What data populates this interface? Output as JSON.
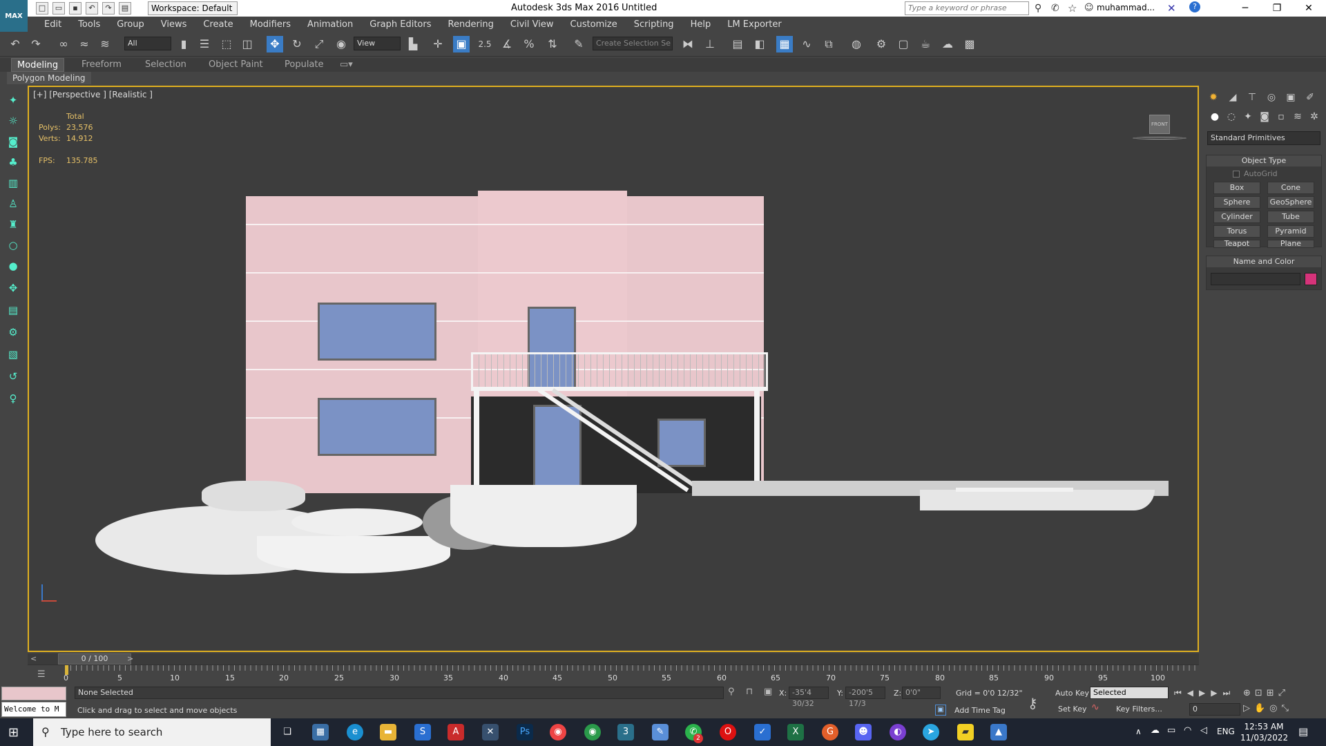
{
  "titlebar": {
    "workspace": "Workspace: Default",
    "app_title": "Autodesk 3ds Max 2016",
    "doc_title": "Untitled",
    "search_placeholder": "Type a keyword or phrase",
    "user": "muhammad..."
  },
  "menu": [
    "Edit",
    "Tools",
    "Group",
    "Views",
    "Create",
    "Modifiers",
    "Animation",
    "Graph Editors",
    "Rendering",
    "Civil View",
    "Customize",
    "Scripting",
    "Help",
    "LM Exporter"
  ],
  "toolbar": {
    "filter_value": "All",
    "ref_coord_value": "View",
    "snap_label": "2.5",
    "selection_set_placeholder": "Create Selection Se"
  },
  "ribbon": {
    "tabs": [
      "Modeling",
      "Freeform",
      "Selection",
      "Object Paint",
      "Populate"
    ],
    "panel_label": "Polygon Modeling"
  },
  "viewport": {
    "label": "[+] [Perspective ] [Realistic ]",
    "stats": {
      "total_label": "Total",
      "polys_label": "Polys:",
      "polys_value": "23,576",
      "verts_label": "Verts:",
      "verts_value": "14,912",
      "fps_label": "FPS:",
      "fps_value": "135.785"
    },
    "viewcube_label": "FRONT"
  },
  "command_panel": {
    "category_dropdown": "Standard Primitives",
    "object_type_title": "Object Type",
    "autogrid_label": "AutoGrid",
    "object_buttons": [
      "Box",
      "Cone",
      "Sphere",
      "GeoSphere",
      "Cylinder",
      "Tube",
      "Torus",
      "Pyramid",
      "Teapot",
      "Plane"
    ],
    "name_color_title": "Name and Color",
    "color_swatch": "#d6337a"
  },
  "timeline": {
    "slider_label": "0 / 100",
    "ticks": [
      "0",
      "5",
      "10",
      "15",
      "20",
      "25",
      "30",
      "35",
      "40",
      "45",
      "50",
      "55",
      "60",
      "65",
      "70",
      "75",
      "80",
      "85",
      "90",
      "95",
      "100"
    ]
  },
  "statusbar": {
    "script_listener": "Welcome to M",
    "selection_status": "None Selected",
    "prompt": "Click and drag to select and move objects",
    "x_label": "X:",
    "x_value": "-35'4 30/32",
    "y_label": "Y:",
    "y_value": "-200'5 17/3",
    "z_label": "Z:",
    "z_value": "0'0\"",
    "grid": "Grid = 0'0 12/32\"",
    "add_time_tag": "Add Time Tag",
    "auto_key": "Auto Key",
    "set_key": "Set Key",
    "key_mode_value": "Selected",
    "key_filters": "Key Filters...",
    "frame_value": "0"
  },
  "taskbar": {
    "search_placeholder": "Type here to search",
    "lang": "ENG",
    "time": "12:53 AM",
    "date": "11/03/2022",
    "notification_count": "2"
  }
}
